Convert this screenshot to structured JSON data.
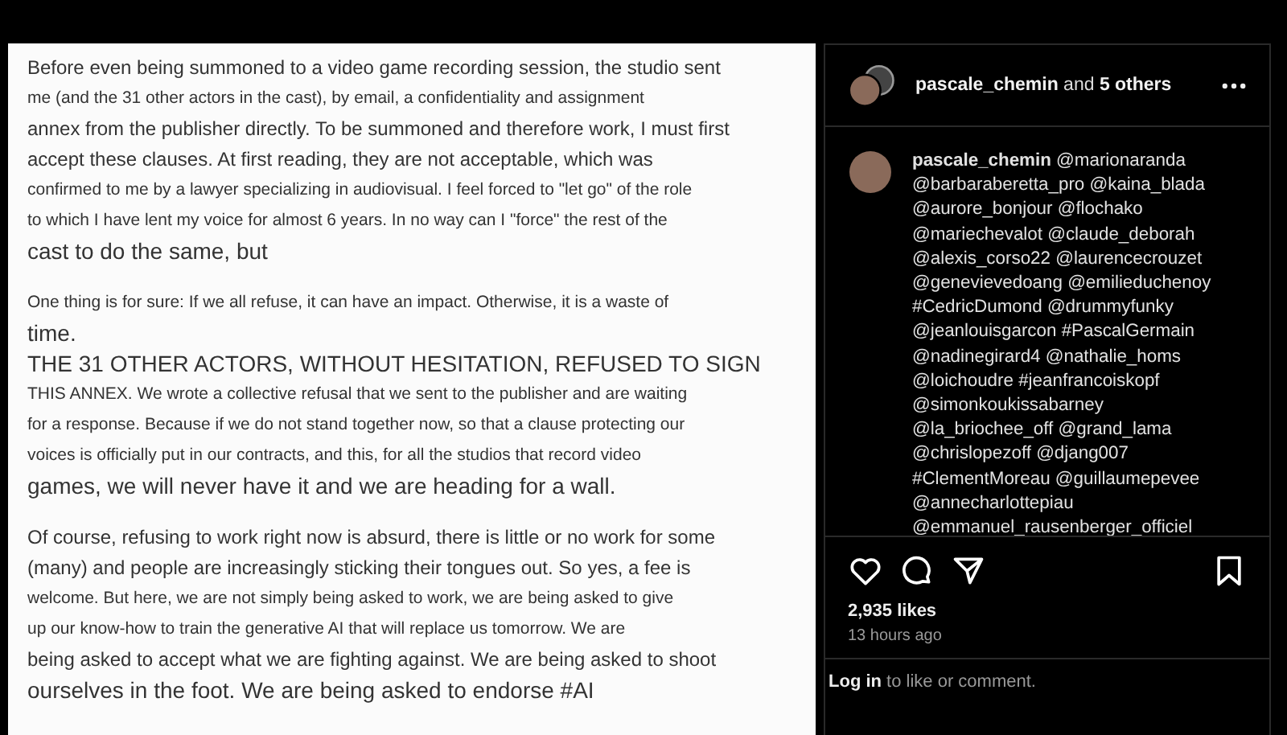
{
  "post_image": {
    "paragraphs": [
      {
        "lines": [
          {
            "kind": "medium",
            "text": "Before even being summoned to a video game recording session, the studio sent"
          },
          {
            "kind": "small",
            "text": "me (and the 31 other actors in the cast), by email, a confidentiality and assignment"
          },
          {
            "kind": "medium",
            "text": "annex from the publisher directly. To be summoned and therefore work, I must first"
          },
          {
            "kind": "medium",
            "text": "accept these clauses. At first reading, they are not acceptable, which was"
          },
          {
            "kind": "small",
            "text": "confirmed to me by a lawyer specializing in audiovisual. I feel forced to \"let go\" of the role"
          },
          {
            "kind": "small",
            "text": "to which I have lent my voice for almost 6 years. In no way can I \"force\" the rest of the"
          },
          {
            "kind": "large",
            "text": "cast to do the same, but"
          }
        ]
      },
      {
        "lines": [
          {
            "kind": "small",
            "text": "One thing is for sure: If we all refuse, it can have an impact. Otherwise, it is a waste of"
          },
          {
            "kind": "large",
            "text": "time."
          },
          {
            "kind": "large",
            "text": "THE 31 OTHER ACTORS, WITHOUT HESITATION, REFUSED TO SIGN"
          },
          {
            "kind": "small",
            "text": "THIS ANNEX. We wrote a collective refusal that we sent to the publisher and are waiting"
          },
          {
            "kind": "small",
            "text": "for a response. Because if we do not stand together now, so that a clause protecting our"
          },
          {
            "kind": "small",
            "text": "voices is officially put in our contracts, and this, for all the studios that record video"
          },
          {
            "kind": "large",
            "text": "games, we will never have it and we are heading for a wall."
          }
        ]
      },
      {
        "lines": [
          {
            "kind": "medium",
            "text": "Of course, refusing to work right now is absurd, there is little or no work for some"
          },
          {
            "kind": "medium",
            "text": "(many) and people are increasingly sticking their tongues out. So yes, a fee is"
          },
          {
            "kind": "small",
            "text": "welcome. But here, we are not simply being asked to work, we are being asked to give"
          },
          {
            "kind": "small",
            "text": "up our know-how to train the generative AI that will replace us tomorrow. We are"
          },
          {
            "kind": "medium",
            "text": "being asked to accept what we are fighting against. We are being asked to shoot"
          },
          {
            "kind": "large",
            "text": "ourselves in the foot. We are being asked to endorse #AI"
          }
        ]
      }
    ]
  },
  "post_header": {
    "text": "**pascale_chemin** and **5 others**"
  },
  "caption": {
    "lines": [
      "**pascale_chemin** @marionaranda",
      "@barbaraberetta_pro @kaina_blada",
      "@aurore_bonjour @flochako",
      "@mariechevalot @claude_deborah",
      "@alexis_corso22 @laurencecrouzet",
      "@genevievedoang @emilieduchenoy",
      "#CedricDumond @drummyfunky",
      "@jeanlouisgarcon #PascalGermain",
      "@nadinegirard4 @nathalie_homs",
      "@loichoudre #jeanfrancoiskopf",
      "@simonkoukissabarney",
      "@la_briochee_off @grand_lama",
      "@chrislopezoff @djang007",
      "#ClementMoreau @guillaumepevee",
      "@annecharlottepiau",
      "@emmanuel_rausenberger_officiel"
    ]
  },
  "likes": "2,935 likes",
  "time": "13 hours ago",
  "login_prompt": "**Log in** to like or comment."
}
